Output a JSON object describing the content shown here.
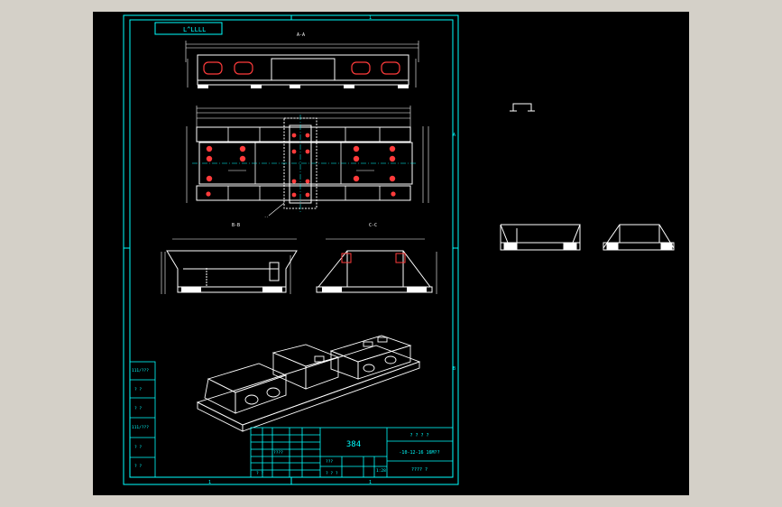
{
  "sheet": {
    "code_box": "L^LLLL",
    "section_left_label": "B-B",
    "section_right_label": "C-C",
    "top_section_label": "A-A"
  },
  "side_notes": [
    "111/???",
    "? ?",
    "? ?",
    "111/???",
    "? ?",
    "? ?"
  ],
  "title_block": {
    "part_number": "384",
    "company": "? ? ? ?",
    "drawing_name": "-10-12-16 16M??",
    "subtitle": "???? ?",
    "count": "???",
    "scale": "1:28",
    "row_a": "????",
    "row_b": "? ? ?",
    "row_c": "? ?"
  },
  "colors": {
    "background": "#000000",
    "frame": "#00ffff",
    "geometry": "#ffffff",
    "dimension": "#ff3b3b",
    "center_marks": "#00ffff",
    "window_chrome": "#d4d0c8"
  }
}
